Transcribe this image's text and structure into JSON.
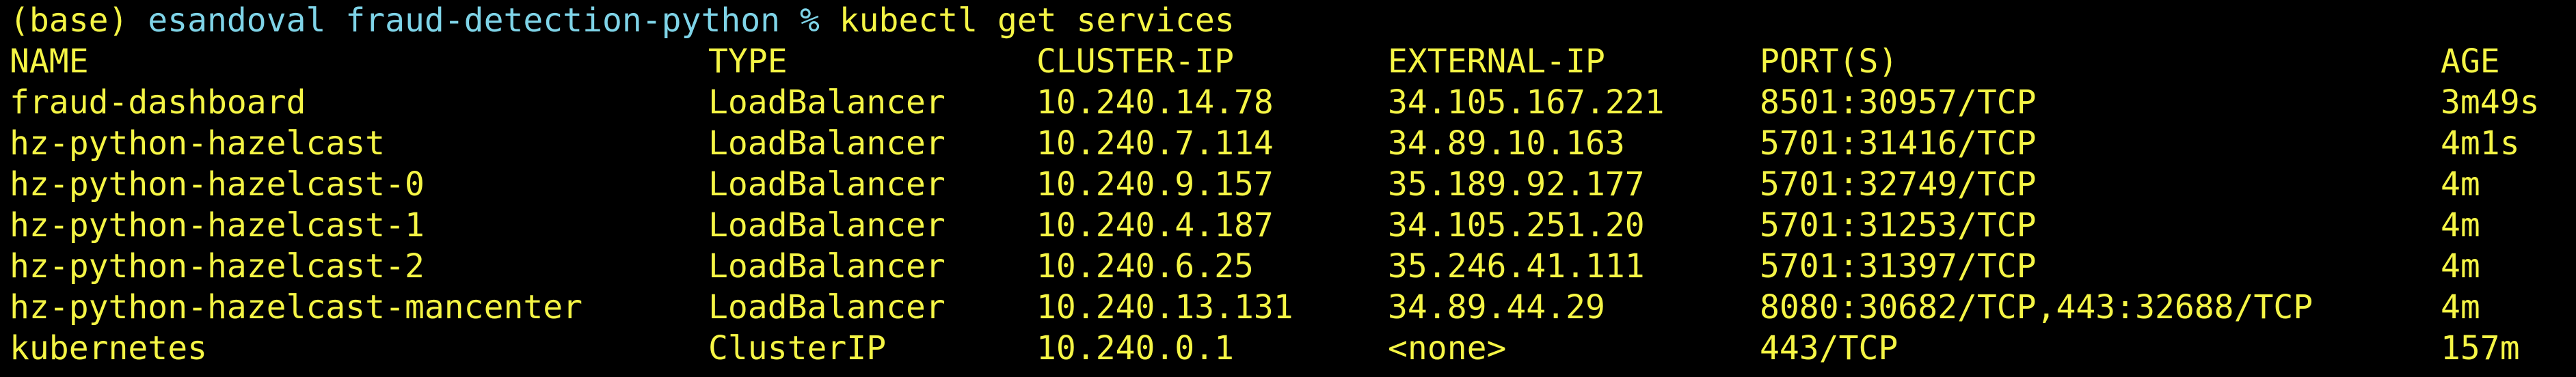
{
  "prompt": {
    "env": "(base)",
    "host": "esandoval fraud-detection-python %",
    "command": "kubectl get services"
  },
  "table": {
    "headers": [
      "NAME",
      "TYPE",
      "CLUSTER-IP",
      "EXTERNAL-IP",
      "PORT(S)",
      "AGE"
    ],
    "rows": [
      [
        "fraud-dashboard",
        "LoadBalancer",
        "10.240.14.78",
        "34.105.167.221",
        "8501:30957/TCP",
        "3m49s"
      ],
      [
        "hz-python-hazelcast",
        "LoadBalancer",
        "10.240.7.114",
        "34.89.10.163",
        "5701:31416/TCP",
        "4m1s"
      ],
      [
        "hz-python-hazelcast-0",
        "LoadBalancer",
        "10.240.9.157",
        "35.189.92.177",
        "5701:32749/TCP",
        "4m"
      ],
      [
        "hz-python-hazelcast-1",
        "LoadBalancer",
        "10.240.4.187",
        "34.105.251.20",
        "5701:31253/TCP",
        "4m"
      ],
      [
        "hz-python-hazelcast-2",
        "LoadBalancer",
        "10.240.6.25",
        "35.246.41.111",
        "5701:31397/TCP",
        "4m"
      ],
      [
        "hz-python-hazelcast-mancenter",
        "LoadBalancer",
        "10.240.13.131",
        "34.89.44.29",
        "8080:30682/TCP,443:32688/TCP",
        "4m"
      ],
      [
        "kubernetes",
        "ClusterIP",
        "10.240.0.1",
        "<none>",
        "443/TCP",
        "157m"
      ]
    ]
  },
  "colors": {
    "background": "#000000",
    "text": "#f5f545",
    "prompt_host": "#7fd4e8"
  }
}
